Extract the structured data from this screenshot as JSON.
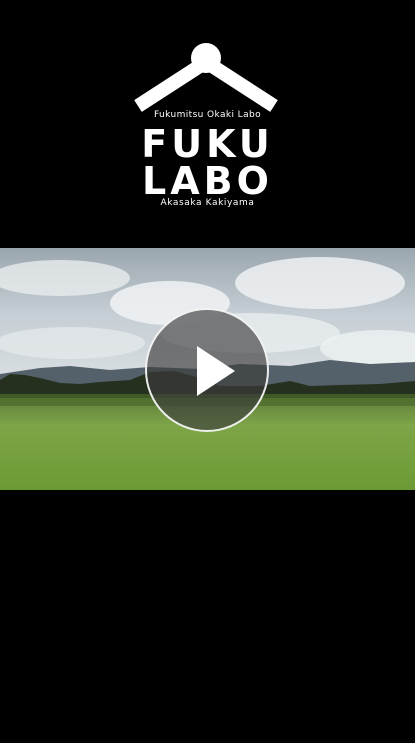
{
  "logo": {
    "tagline": "Fukumitsu Okaki Labo",
    "title_line1": "FUKU",
    "title_line2": "LABO",
    "subtitle": "Akasaka Kakiyama"
  },
  "video": {
    "state": "paused",
    "icon": "play-icon"
  },
  "colors": {
    "background": "#000000",
    "logo": "#ffffff",
    "sky": "#c9d2d8",
    "field": "#6f9a3a"
  }
}
